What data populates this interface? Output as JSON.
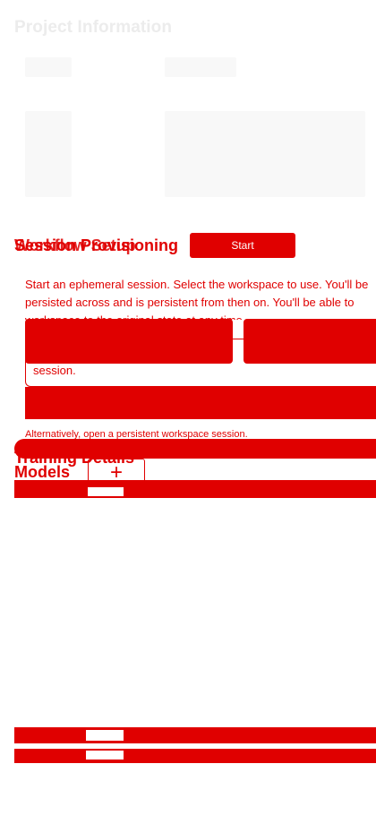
{
  "header": {
    "title": "Project Information"
  },
  "session": {
    "heading_a": "Session Provisioning",
    "heading_b": "Models",
    "heading_c": "Workflow Setup",
    "start_button": "Start",
    "description_line1": "Start an ephemeral session. Select the workspace to use. You'll be",
    "description_line2": "persisted across and is persistent from then on. You'll be able to",
    "description_line3": "workspace to the original state at any time.",
    "notice_text": "session.",
    "alt_text": "Alternatively, open a persistent workspace session."
  },
  "training": {
    "heading": "Training Details",
    "models_label": "Models",
    "add_label": "+"
  },
  "colors": {
    "accent": "#e00000",
    "skeleton": "#f8f8f8",
    "title_ghost": "#ececec"
  }
}
